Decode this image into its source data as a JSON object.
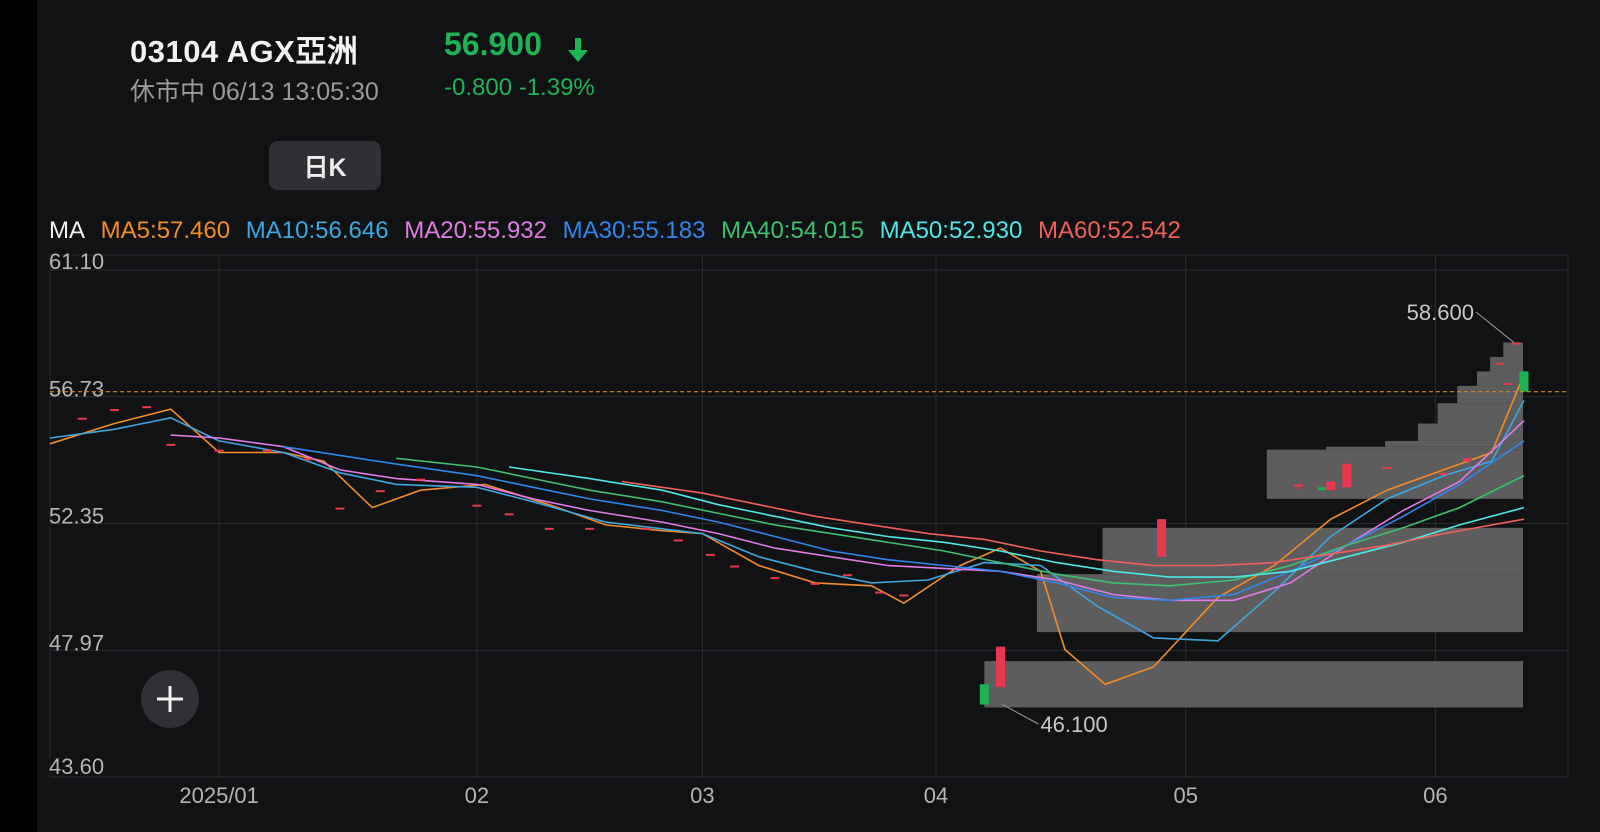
{
  "header": {
    "code_name": "03104  AGX亞洲",
    "status": "休市中 06/13 13:05:30",
    "price": "56.900",
    "change": "-0.800 -1.39%"
  },
  "icons": {
    "price_direction": "down-arrow-icon",
    "add": "plus-icon"
  },
  "colors": {
    "up": "#e8384f",
    "down": "#1fb356",
    "volume_profile": "#6b6b6b",
    "last_price_line": "#d9822b"
  },
  "period_tab": {
    "label": "日K"
  },
  "ma_legend": {
    "label": "MA",
    "items": [
      {
        "text": "MA5:57.460",
        "color": "#f28c28"
      },
      {
        "text": "MA10:56.646",
        "color": "#3ea6e0"
      },
      {
        "text": "MA20:55.932",
        "color": "#e07be6"
      },
      {
        "text": "MA30:55.183",
        "color": "#2f86eb"
      },
      {
        "text": "MA40:54.015",
        "color": "#3fbf6f"
      },
      {
        "text": "MA50:52.930",
        "color": "#4ee6e6"
      },
      {
        "text": "MA60:52.542",
        "color": "#f0605a"
      }
    ]
  },
  "chart_data": {
    "type": "candlestick",
    "ylim": [
      43.6,
      61.1
    ],
    "y_ticks": [
      "61.10",
      "56.73",
      "52.35",
      "47.97",
      "43.60"
    ],
    "y_tick_values": [
      61.1,
      56.73,
      52.35,
      47.97,
      43.6
    ],
    "x_range": [
      "2024-12-12",
      "2025-06-13"
    ],
    "x_ticks": [
      {
        "label": "2025/01",
        "date": "2025-01-02"
      },
      {
        "label": "02",
        "date": "2025-02-03"
      },
      {
        "label": "03",
        "date": "2025-03-03"
      },
      {
        "label": "04",
        "date": "2025-04-01"
      },
      {
        "label": "05",
        "date": "2025-05-02"
      },
      {
        "label": "06",
        "date": "2025-06-02"
      }
    ],
    "last_price": 56.9,
    "high_marker": {
      "label": "58.600",
      "value": 58.6,
      "date": "2025-06-12"
    },
    "low_marker": {
      "label": "46.100",
      "value": 46.1,
      "date": "2025-04-09"
    },
    "candles": [
      {
        "date": "2024-12-16",
        "o": 56.0,
        "h": 56.0,
        "l": 56.0,
        "c": 56.0
      },
      {
        "date": "2024-12-20",
        "o": 56.3,
        "h": 56.3,
        "l": 56.3,
        "c": 56.3
      },
      {
        "date": "2024-12-24",
        "o": 56.4,
        "h": 56.4,
        "l": 56.4,
        "c": 56.4
      },
      {
        "date": "2024-12-27",
        "o": 55.1,
        "h": 55.1,
        "l": 55.1,
        "c": 55.1
      },
      {
        "date": "2025-01-02",
        "o": 54.9,
        "h": 54.9,
        "l": 54.9,
        "c": 54.9
      },
      {
        "date": "2025-01-08",
        "o": 54.9,
        "h": 54.9,
        "l": 54.9,
        "c": 54.9
      },
      {
        "date": "2025-01-13",
        "o": 54.6,
        "h": 54.6,
        "l": 54.6,
        "c": 54.6
      },
      {
        "date": "2025-01-17",
        "o": 52.9,
        "h": 52.9,
        "l": 52.9,
        "c": 52.9
      },
      {
        "date": "2025-01-22",
        "o": 53.5,
        "h": 53.5,
        "l": 53.5,
        "c": 53.5
      },
      {
        "date": "2025-01-27",
        "o": 53.9,
        "h": 53.9,
        "l": 53.9,
        "c": 53.9
      },
      {
        "date": "2025-02-03",
        "o": 53.0,
        "h": 53.0,
        "l": 53.0,
        "c": 53.0
      },
      {
        "date": "2025-02-07",
        "o": 52.7,
        "h": 52.7,
        "l": 52.7,
        "c": 52.7
      },
      {
        "date": "2025-02-12",
        "o": 52.2,
        "h": 52.2,
        "l": 52.2,
        "c": 52.2
      },
      {
        "date": "2025-02-17",
        "o": 52.2,
        "h": 52.2,
        "l": 52.2,
        "c": 52.2
      },
      {
        "date": "2025-02-24",
        "o": 52.2,
        "h": 52.2,
        "l": 52.2,
        "c": 52.2
      },
      {
        "date": "2025-02-28",
        "o": 51.8,
        "h": 51.8,
        "l": 51.8,
        "c": 51.8
      },
      {
        "date": "2025-03-04",
        "o": 51.3,
        "h": 51.3,
        "l": 51.3,
        "c": 51.3
      },
      {
        "date": "2025-03-07",
        "o": 50.9,
        "h": 50.9,
        "l": 50.9,
        "c": 50.9
      },
      {
        "date": "2025-03-12",
        "o": 50.5,
        "h": 50.5,
        "l": 50.5,
        "c": 50.5
      },
      {
        "date": "2025-03-17",
        "o": 50.3,
        "h": 50.3,
        "l": 50.3,
        "c": 50.3
      },
      {
        "date": "2025-03-21",
        "o": 50.6,
        "h": 50.6,
        "l": 50.6,
        "c": 50.6
      },
      {
        "date": "2025-03-25",
        "o": 50.0,
        "h": 50.0,
        "l": 50.0,
        "c": 50.0
      },
      {
        "date": "2025-03-28",
        "o": 49.9,
        "h": 49.9,
        "l": 49.9,
        "c": 49.9
      },
      {
        "date": "2025-04-07",
        "o": 46.8,
        "h": 46.8,
        "l": 46.1,
        "c": 46.1
      },
      {
        "date": "2025-04-09",
        "o": 46.7,
        "h": 48.1,
        "l": 46.7,
        "c": 48.1
      },
      {
        "date": "2025-04-29",
        "o": 51.2,
        "h": 52.5,
        "l": 51.2,
        "c": 52.5
      },
      {
        "date": "2025-05-16",
        "o": 53.7,
        "h": 53.7,
        "l": 53.5,
        "c": 53.7
      },
      {
        "date": "2025-05-19",
        "o": 53.6,
        "h": 53.6,
        "l": 53.5,
        "c": 53.5
      },
      {
        "date": "2025-05-20",
        "o": 53.5,
        "h": 53.8,
        "l": 53.5,
        "c": 53.8
      },
      {
        "date": "2025-05-22",
        "o": 53.6,
        "h": 54.5,
        "l": 53.6,
        "c": 54.4
      },
      {
        "date": "2025-05-27",
        "o": 54.3,
        "h": 54.3,
        "l": 54.3,
        "c": 54.3
      },
      {
        "date": "2025-06-03",
        "o": 54.1,
        "h": 54.1,
        "l": 54.1,
        "c": 54.1
      },
      {
        "date": "2025-06-06",
        "o": 54.5,
        "h": 54.6,
        "l": 54.4,
        "c": 54.6
      },
      {
        "date": "2025-06-10",
        "o": 57.9,
        "h": 57.9,
        "l": 57.9,
        "c": 57.9
      },
      {
        "date": "2025-06-11",
        "o": 57.2,
        "h": 57.2,
        "l": 57.2,
        "c": 57.2
      },
      {
        "date": "2025-06-12",
        "o": 58.6,
        "h": 58.6,
        "l": 58.6,
        "c": 58.6
      },
      {
        "date": "2025-06-13",
        "o": 57.6,
        "h": 57.6,
        "l": 56.9,
        "c": 56.9
      }
    ],
    "ma_series": [
      {
        "name": "MA5",
        "color": "#f28c28",
        "points": [
          [
            "2024-12-12",
            55.1
          ],
          [
            "2024-12-20",
            55.8
          ],
          [
            "2024-12-27",
            56.3
          ],
          [
            "2025-01-02",
            54.8
          ],
          [
            "2025-01-10",
            54.8
          ],
          [
            "2025-01-15",
            54.5
          ],
          [
            "2025-01-21",
            52.9
          ],
          [
            "2025-01-27",
            53.5
          ],
          [
            "2025-02-04",
            53.7
          ],
          [
            "2025-02-12",
            53.0
          ],
          [
            "2025-02-19",
            52.3
          ],
          [
            "2025-02-26",
            52.1
          ],
          [
            "2025-03-03",
            52.0
          ],
          [
            "2025-03-10",
            50.9
          ],
          [
            "2025-03-17",
            50.3
          ],
          [
            "2025-03-24",
            50.2
          ],
          [
            "2025-03-28",
            49.6
          ],
          [
            "2025-04-04",
            50.9
          ],
          [
            "2025-04-09",
            51.5
          ],
          [
            "2025-04-14",
            50.7
          ],
          [
            "2025-04-17",
            48.0
          ],
          [
            "2025-04-22",
            46.8
          ],
          [
            "2025-04-28",
            47.4
          ],
          [
            "2025-05-06",
            49.8
          ],
          [
            "2025-05-13",
            50.9
          ],
          [
            "2025-05-20",
            52.5
          ],
          [
            "2025-05-27",
            53.5
          ],
          [
            "2025-06-03",
            54.2
          ],
          [
            "2025-06-09",
            54.8
          ],
          [
            "2025-06-13",
            57.5
          ]
        ]
      },
      {
        "name": "MA10",
        "color": "#3ea6e0",
        "points": [
          [
            "2024-12-12",
            55.3
          ],
          [
            "2024-12-20",
            55.6
          ],
          [
            "2024-12-27",
            56.0
          ],
          [
            "2025-01-02",
            55.2
          ],
          [
            "2025-01-10",
            54.8
          ],
          [
            "2025-01-17",
            54.1
          ],
          [
            "2025-01-24",
            53.7
          ],
          [
            "2025-02-03",
            53.6
          ],
          [
            "2025-02-10",
            53.1
          ],
          [
            "2025-02-19",
            52.4
          ],
          [
            "2025-03-03",
            52.0
          ],
          [
            "2025-03-10",
            51.2
          ],
          [
            "2025-03-17",
            50.7
          ],
          [
            "2025-03-24",
            50.3
          ],
          [
            "2025-03-31",
            50.4
          ],
          [
            "2025-04-07",
            51.0
          ],
          [
            "2025-04-14",
            50.9
          ],
          [
            "2025-04-21",
            49.5
          ],
          [
            "2025-04-28",
            48.4
          ],
          [
            "2025-05-06",
            48.3
          ],
          [
            "2025-05-13",
            50.0
          ],
          [
            "2025-05-20",
            51.9
          ],
          [
            "2025-05-27",
            53.2
          ],
          [
            "2025-06-03",
            54.0
          ],
          [
            "2025-06-09",
            54.5
          ],
          [
            "2025-06-13",
            56.6
          ]
        ]
      },
      {
        "name": "MA20",
        "color": "#e07be6",
        "points": [
          [
            "2024-12-27",
            55.4
          ],
          [
            "2025-01-02",
            55.3
          ],
          [
            "2025-01-10",
            55.0
          ],
          [
            "2025-01-17",
            54.2
          ],
          [
            "2025-01-24",
            53.9
          ],
          [
            "2025-02-03",
            53.7
          ],
          [
            "2025-02-10",
            53.2
          ],
          [
            "2025-02-17",
            52.8
          ],
          [
            "2025-02-26",
            52.4
          ],
          [
            "2025-03-05",
            52.0
          ],
          [
            "2025-03-12",
            51.5
          ],
          [
            "2025-03-19",
            51.2
          ],
          [
            "2025-03-26",
            50.9
          ],
          [
            "2025-04-02",
            50.8
          ],
          [
            "2025-04-09",
            50.7
          ],
          [
            "2025-04-16",
            50.4
          ],
          [
            "2025-04-23",
            49.9
          ],
          [
            "2025-04-30",
            49.7
          ],
          [
            "2025-05-08",
            49.7
          ],
          [
            "2025-05-15",
            50.3
          ],
          [
            "2025-05-22",
            51.6
          ],
          [
            "2025-05-29",
            52.8
          ],
          [
            "2025-06-05",
            53.8
          ],
          [
            "2025-06-13",
            55.9
          ]
        ]
      },
      {
        "name": "MA30",
        "color": "#2f86eb",
        "points": [
          [
            "2025-01-10",
            55.0
          ],
          [
            "2025-01-17",
            54.7
          ],
          [
            "2025-01-24",
            54.4
          ],
          [
            "2025-02-03",
            54.0
          ],
          [
            "2025-02-10",
            53.6
          ],
          [
            "2025-02-17",
            53.2
          ],
          [
            "2025-02-26",
            52.8
          ],
          [
            "2025-03-05",
            52.4
          ],
          [
            "2025-03-12",
            51.9
          ],
          [
            "2025-03-19",
            51.4
          ],
          [
            "2025-03-26",
            51.1
          ],
          [
            "2025-04-02",
            50.9
          ],
          [
            "2025-04-09",
            50.7
          ],
          [
            "2025-04-16",
            50.3
          ],
          [
            "2025-04-23",
            49.8
          ],
          [
            "2025-04-30",
            49.7
          ],
          [
            "2025-05-08",
            49.9
          ],
          [
            "2025-05-15",
            50.7
          ],
          [
            "2025-05-22",
            51.6
          ],
          [
            "2025-05-29",
            52.6
          ],
          [
            "2025-06-05",
            53.7
          ],
          [
            "2025-06-13",
            55.2
          ]
        ]
      },
      {
        "name": "MA40",
        "color": "#3fbf6f",
        "points": [
          [
            "2025-01-24",
            54.6
          ],
          [
            "2025-02-03",
            54.3
          ],
          [
            "2025-02-10",
            53.9
          ],
          [
            "2025-02-17",
            53.5
          ],
          [
            "2025-02-26",
            53.1
          ],
          [
            "2025-03-05",
            52.7
          ],
          [
            "2025-03-12",
            52.3
          ],
          [
            "2025-03-19",
            52.0
          ],
          [
            "2025-03-26",
            51.7
          ],
          [
            "2025-04-02",
            51.4
          ],
          [
            "2025-04-09",
            51.0
          ],
          [
            "2025-04-16",
            50.6
          ],
          [
            "2025-04-23",
            50.3
          ],
          [
            "2025-04-30",
            50.2
          ],
          [
            "2025-05-08",
            50.4
          ],
          [
            "2025-05-15",
            50.9
          ],
          [
            "2025-05-22",
            51.6
          ],
          [
            "2025-05-29",
            52.2
          ],
          [
            "2025-06-05",
            52.9
          ],
          [
            "2025-06-13",
            54.0
          ]
        ]
      },
      {
        "name": "MA50",
        "color": "#4ee6e6",
        "points": [
          [
            "2025-02-07",
            54.3
          ],
          [
            "2025-02-17",
            53.9
          ],
          [
            "2025-02-26",
            53.5
          ],
          [
            "2025-03-05",
            53.0
          ],
          [
            "2025-03-12",
            52.6
          ],
          [
            "2025-03-19",
            52.2
          ],
          [
            "2025-03-26",
            51.9
          ],
          [
            "2025-04-02",
            51.7
          ],
          [
            "2025-04-09",
            51.4
          ],
          [
            "2025-04-16",
            51.0
          ],
          [
            "2025-04-23",
            50.7
          ],
          [
            "2025-04-30",
            50.5
          ],
          [
            "2025-05-08",
            50.5
          ],
          [
            "2025-05-15",
            50.7
          ],
          [
            "2025-05-22",
            51.2
          ],
          [
            "2025-05-29",
            51.7
          ],
          [
            "2025-06-05",
            52.3
          ],
          [
            "2025-06-13",
            52.9
          ]
        ]
      },
      {
        "name": "MA60",
        "color": "#f0605a",
        "points": [
          [
            "2025-02-21",
            53.8
          ],
          [
            "2025-03-03",
            53.4
          ],
          [
            "2025-03-10",
            53.0
          ],
          [
            "2025-03-17",
            52.6
          ],
          [
            "2025-03-24",
            52.3
          ],
          [
            "2025-03-31",
            52.0
          ],
          [
            "2025-04-07",
            51.8
          ],
          [
            "2025-04-14",
            51.4
          ],
          [
            "2025-04-21",
            51.1
          ],
          [
            "2025-04-28",
            50.9
          ],
          [
            "2025-05-06",
            50.9
          ],
          [
            "2025-05-13",
            51.0
          ],
          [
            "2025-05-20",
            51.3
          ],
          [
            "2025-05-27",
            51.6
          ],
          [
            "2025-06-03",
            52.0
          ],
          [
            "2025-06-13",
            52.5
          ]
        ]
      }
    ],
    "volume_profile": {
      "start_date": "2025-04-07",
      "end_date": "2025-06-13",
      "bins": [
        {
          "price_low": 58.1,
          "price_high": 58.6,
          "weight": 0.03
        },
        {
          "price_low": 57.6,
          "price_high": 58.1,
          "weight": 0.05
        },
        {
          "price_low": 57.1,
          "price_high": 57.6,
          "weight": 0.07
        },
        {
          "price_low": 56.5,
          "price_high": 57.1,
          "weight": 0.1
        },
        {
          "price_low": 55.8,
          "price_high": 56.5,
          "weight": 0.13
        },
        {
          "price_low": 55.2,
          "price_high": 55.8,
          "weight": 0.16
        },
        {
          "price_low": 55.0,
          "price_high": 55.2,
          "weight": 0.21
        },
        {
          "price_low": 54.9,
          "price_high": 55.0,
          "weight": 0.3
        },
        {
          "price_low": 53.2,
          "price_high": 54.9,
          "weight": 0.39
        },
        {
          "price_low": 52.2,
          "price_high": 53.2,
          "weight": 0.0
        },
        {
          "price_low": 50.6,
          "price_high": 52.2,
          "weight": 0.64
        },
        {
          "price_low": 48.6,
          "price_high": 50.6,
          "weight": 0.74
        },
        {
          "price_low": 47.6,
          "price_high": 48.6,
          "weight": 0.0
        },
        {
          "price_low": 46.0,
          "price_high": 47.6,
          "weight": 0.82
        }
      ]
    }
  }
}
